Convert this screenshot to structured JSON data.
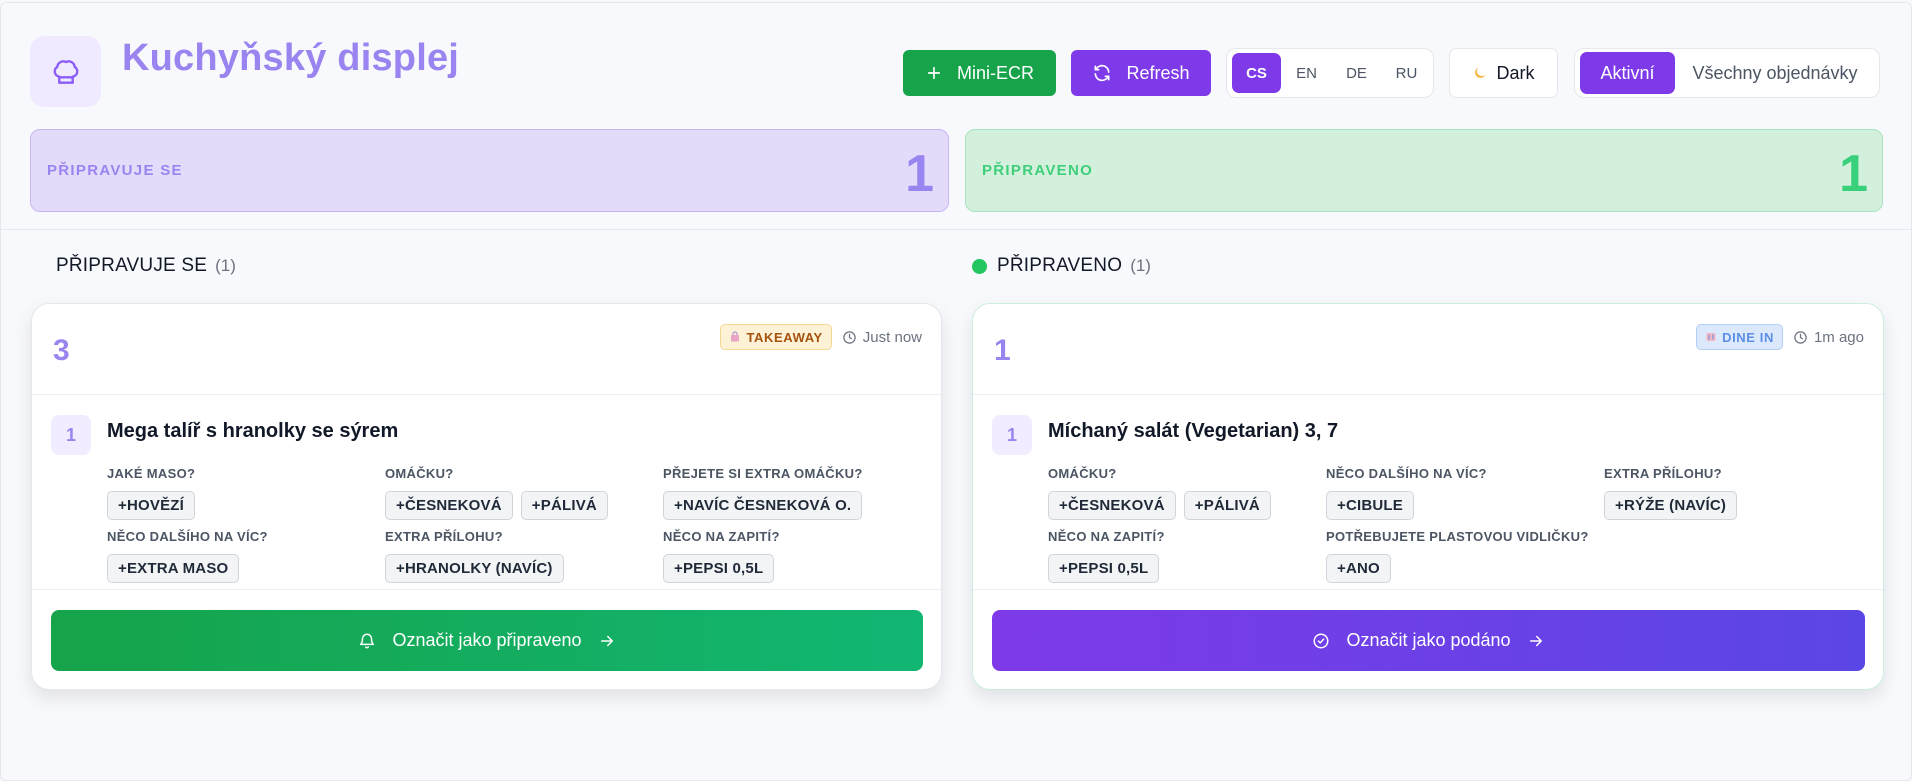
{
  "header": {
    "title": "Kuchyňský displej",
    "logo_icon": "chef-hat-icon",
    "mini_ecr_label": "Mini-ECR",
    "refresh_label": "Refresh",
    "languages": [
      "CS",
      "EN",
      "DE",
      "RU"
    ],
    "active_language": "CS",
    "dark_label": "Dark",
    "filter_active_label": "Aktivní",
    "filter_all_label": "Všechny objednávky"
  },
  "stats": {
    "preparing": {
      "label": "PŘIPRAVUJE SE",
      "value": "1"
    },
    "ready": {
      "label": "PŘIPRAVENO",
      "value": "1"
    }
  },
  "columns": {
    "preparing": {
      "title": "PŘIPRAVUJE SE",
      "count": "(1)",
      "card": {
        "order_number": "3",
        "badge": "TAKEAWAY",
        "time": "Just now",
        "item": {
          "qty": "1",
          "name": "Mega talíř s hranolky se sýrem",
          "options": [
            {
              "label": "JAKÉ MASO?",
              "values": [
                "+HOVĚZÍ"
              ]
            },
            {
              "label": "OMÁČKU?",
              "values": [
                "+ČESNEKOVÁ",
                "+PÁLIVÁ"
              ]
            },
            {
              "label": "PŘEJETE SI EXTRA OMÁČKU?",
              "values": [
                "+NAVÍC ČESNEKOVÁ O."
              ]
            },
            {
              "label": "NĚCO DALŠÍHO NA VÍC?",
              "values": [
                "+EXTRA MASO"
              ]
            },
            {
              "label": "EXTRA PŘÍLOHU?",
              "values": [
                "+HRANOLKY (NAVÍC)"
              ]
            },
            {
              "label": "NĚCO NA ZAPITÍ?",
              "values": [
                "+PEPSI 0,5L"
              ]
            }
          ]
        },
        "action_label": "Označit jako připraveno"
      }
    },
    "ready": {
      "title": "PŘIPRAVENO",
      "count": "(1)",
      "card": {
        "order_number": "1",
        "badge": "DINE IN",
        "time": "1m ago",
        "item": {
          "qty": "1",
          "name": "Míchaný salát (Vegetarian) 3, 7",
          "options": [
            {
              "label": "OMÁČKU?",
              "values": [
                "+ČESNEKOVÁ",
                "+PÁLIVÁ"
              ]
            },
            {
              "label": "NĚCO DALŠÍHO NA VÍC?",
              "values": [
                "+CIBULE"
              ]
            },
            {
              "label": "EXTRA PŘÍLOHU?",
              "values": [
                "+RÝŽE (NAVÍC)"
              ]
            },
            {
              "label": "NĚCO NA ZAPITÍ?",
              "values": [
                "+PEPSI 0,5L"
              ]
            },
            {
              "label": "POTŘEBUJETE PLASTOVOU VIDLIČKU?",
              "values": [
                "+ANO"
              ]
            }
          ]
        },
        "action_label": "Označit jako podáno"
      }
    }
  },
  "colors": {
    "accent_purple": "#7e3ae9",
    "accent_green": "#16a34a",
    "title_purple": "#9a84ef",
    "ready_green": "#38d07a"
  }
}
